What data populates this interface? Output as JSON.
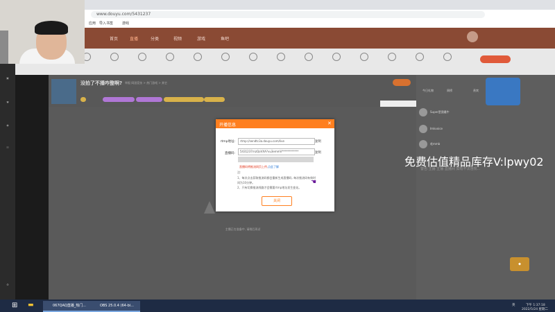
{
  "browser": {
    "url": "www.douyu.com/5431237",
    "bookmarks": [
      "应用",
      "导入书签",
      "游戏"
    ]
  },
  "site_nav": {
    "items": [
      "首页",
      "直播",
      "分类",
      "视频",
      "游戏",
      "鱼吧"
    ],
    "active": "直播"
  },
  "room": {
    "title": "没拍了不播咋整啊?",
    "meta": "举报   网游竞技 > 热门游戏 > 其它"
  },
  "right_panel": {
    "tabs": [
      "今日礼物",
      "周榜",
      "贵宾"
    ],
    "rank_names": [
      "Super是我最牛",
      "Imkvoice",
      "毛mmb"
    ],
    "notice": "警告:主播 主播 直播间 如有不法违规..."
  },
  "video": {
    "status_text": "主播正在准备中, 请稍后再试"
  },
  "dialog": {
    "title": "开播信息",
    "rtmp_label": "rtmp地址:",
    "rtmp_value": "rtmp://sendtc3a.douyu.com/live",
    "key_label": "直播码:",
    "key_value": "5431237rnzQoVXA?vu3emmV************",
    "copy_label": "复制",
    "warning": "直播码将推流网页上传,",
    "link": "点此了解",
    "note_title": "注:",
    "note_1": "1、每次点击获取推流码都会重新生成直播码, 每次推流码有效时间为10分钟。",
    "note_2": "2、只有切换推流线路才会需要rtmp地址发生变化。",
    "close_label": "关闭"
  },
  "overlay": {
    "watermark": "免费估值精品库存V:lpwy02"
  },
  "taskbar": {
    "tasks": [
      "067QAQ直播_热门...",
      "OBS 25.0.4 (64-bi..."
    ],
    "lang": "英",
    "time": "下午 1:37:18",
    "date": "2022/5/24 星期二"
  },
  "colors": {
    "accent": "#ff7f1f",
    "nav_bg": "#8a4a34",
    "taskbar": "#1e2b44"
  }
}
